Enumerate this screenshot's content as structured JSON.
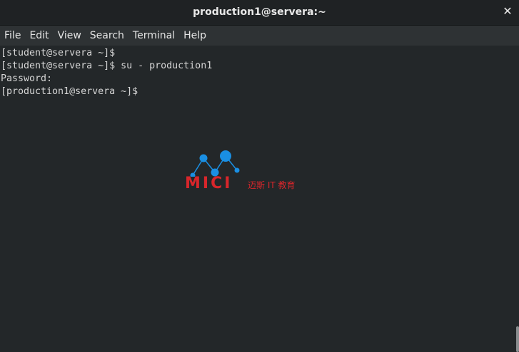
{
  "window": {
    "title": "production1@servera:~",
    "close_glyph": "✕"
  },
  "menu": {
    "items": [
      "File",
      "Edit",
      "View",
      "Search",
      "Terminal",
      "Help"
    ]
  },
  "terminal": {
    "lines": [
      "[student@servera ~]$",
      "[student@servera ~]$ su - production1",
      "Password:",
      "[production1@servera ~]$"
    ]
  },
  "watermark": {
    "brand": "MICI",
    "subtitle": "迈斯 IT 教育",
    "color": "#d8262b",
    "node_color": "#1a8fe3"
  },
  "colors": {
    "titlebar": "#1f2224",
    "menubar": "#2e3234",
    "terminal_bg": "#232729",
    "terminal_fg": "#d6d6d6"
  }
}
